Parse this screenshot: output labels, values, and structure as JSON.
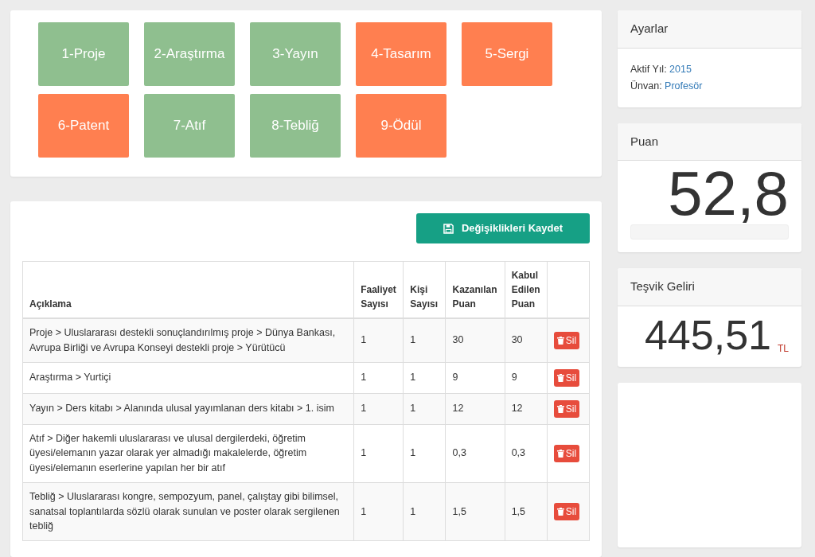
{
  "categories": [
    {
      "label": "1-Proje",
      "color": "#8fbf8f"
    },
    {
      "label": "2-Araştırma",
      "color": "#8fbf8f"
    },
    {
      "label": "3-Yayın",
      "color": "#8fbf8f"
    },
    {
      "label": "4-Tasarım",
      "color": "#ff7f50"
    },
    {
      "label": "5-Sergi",
      "color": "#ff7f50"
    },
    {
      "label": "6-Patent",
      "color": "#ff7f50"
    },
    {
      "label": "7-Atıf",
      "color": "#8fbf8f"
    },
    {
      "label": "8-Tebliğ",
      "color": "#8fbf8f"
    },
    {
      "label": "9-Ödül",
      "color": "#ff7f50"
    }
  ],
  "save_button": "Değişiklikleri Kaydet",
  "table": {
    "columns": [
      "Açıklama",
      "Faaliyet Sayısı",
      "Kişi Sayısı",
      "Kazanılan Puan",
      "Kabul Edilen Puan"
    ],
    "rows": [
      {
        "cells": [
          "Proje > Uluslararası destekli sonuçlandırılmış proje > Dünya Bankası, Avrupa Birliği ve Avrupa Konseyi destekli proje > Yürütücü",
          "1",
          "1",
          "30",
          "30"
        ],
        "delete_label": "Sil"
      },
      {
        "cells": [
          "Araştırma > Yurtiçi",
          "1",
          "1",
          "9",
          "9"
        ],
        "delete_label": "Sil"
      },
      {
        "cells": [
          "Yayın > Ders kitabı > Alanında ulusal yayımlanan ders kitabı > 1. isim",
          "1",
          "1",
          "12",
          "12"
        ],
        "delete_label": "Sil"
      },
      {
        "cells": [
          "Atıf > Diğer hakemli uluslararası ve ulusal dergilerdeki, öğretim üyesi/elemanın yazar olarak yer almadığı makalelerde, öğretim üyesi/elemanın eserlerine yapılan her bir atıf",
          "1",
          "1",
          "0,3",
          "0,3"
        ],
        "delete_label": "Sil"
      },
      {
        "cells": [
          "Tebliğ > Uluslararası kongre, sempozyum, panel, çalıştay gibi bilimsel, sanatsal toplantılarda sözlü olarak sunulan ve poster olarak sergilenen tebliğ",
          "1",
          "1",
          "1,5",
          "1,5"
        ],
        "delete_label": "Sil"
      }
    ]
  },
  "settings": {
    "title": "Ayarlar",
    "fields": [
      {
        "label": "Aktif Yıl:",
        "value": "2015"
      },
      {
        "label": "Ünvan:",
        "value": "Profesör"
      }
    ]
  },
  "score": {
    "title": "Puan",
    "value": "52,8",
    "level": 0
  },
  "income": {
    "title": "Teşvik Geliri",
    "value": "445,51",
    "unit": "TL"
  }
}
